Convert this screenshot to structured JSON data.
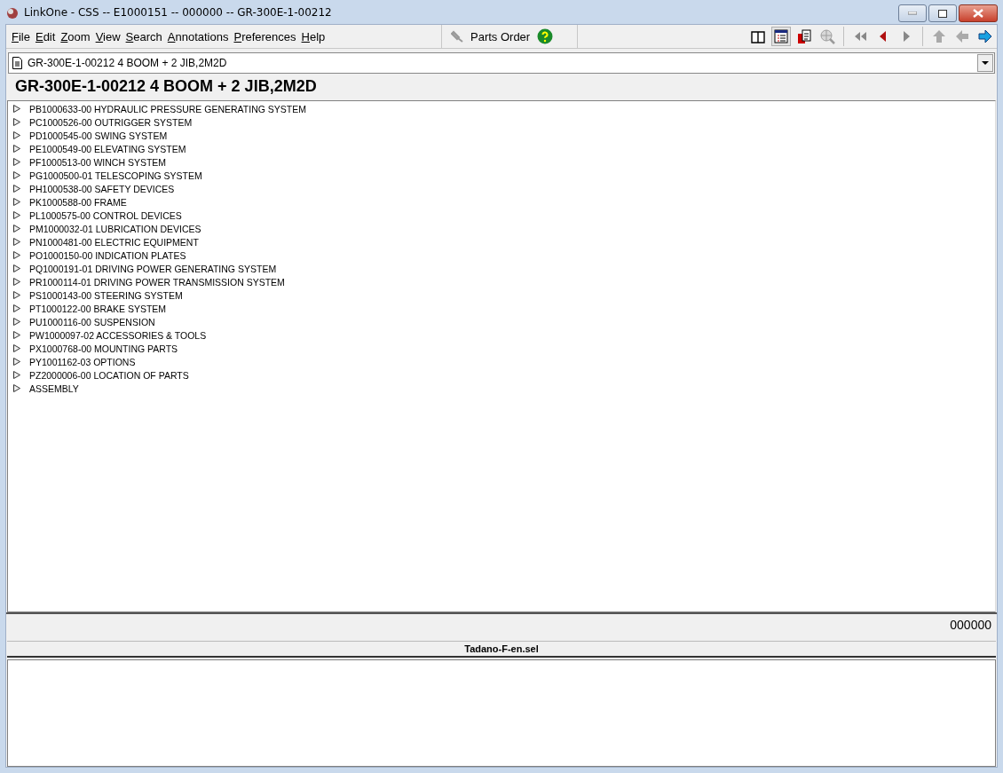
{
  "window": {
    "title": "LinkOne - CSS -- E1000151 -- 000000 -- GR-300E-1-00212"
  },
  "menu": [
    "File",
    "Edit",
    "Zoom",
    "View",
    "Search",
    "Annotations",
    "Preferences",
    "Help"
  ],
  "parts_order": {
    "label": "Parts Order"
  },
  "toolbar": [
    {
      "kind": "book",
      "disabled": false,
      "pressed": false
    },
    {
      "kind": "list",
      "disabled": false,
      "pressed": true
    },
    {
      "kind": "pages",
      "disabled": false,
      "pressed": false
    },
    {
      "kind": "globe-search",
      "disabled": true,
      "pressed": false
    },
    {
      "kind": "first",
      "disabled": true,
      "pressed": false
    },
    {
      "kind": "prev",
      "disabled": false,
      "pressed": false
    },
    {
      "kind": "next",
      "disabled": true,
      "pressed": false
    },
    {
      "kind": "up",
      "disabled": true,
      "pressed": false
    },
    {
      "kind": "back",
      "disabled": true,
      "pressed": false
    },
    {
      "kind": "forward",
      "disabled": false,
      "pressed": false
    }
  ],
  "document_select": {
    "value": "GR-300E-1-00212 4 BOOM + 2 JIB,2M2D"
  },
  "heading": "GR-300E-1-00212 4 BOOM + 2 JIB,2M2D",
  "tree": [
    {
      "label": "PB1000633-00 HYDRAULIC PRESSURE GENERATING SYSTEM"
    },
    {
      "label": "PC1000526-00 OUTRIGGER SYSTEM"
    },
    {
      "label": "PD1000545-00 SWING SYSTEM"
    },
    {
      "label": "PE1000549-00 ELEVATING SYSTEM"
    },
    {
      "label": "PF1000513-00 WINCH SYSTEM"
    },
    {
      "label": "PG1000500-01 TELESCOPING SYSTEM"
    },
    {
      "label": "PH1000538-00 SAFETY DEVICES"
    },
    {
      "label": "PK1000588-00 FRAME"
    },
    {
      "label": "PL1000575-00 CONTROL DEVICES"
    },
    {
      "label": "PM1000032-01 LUBRICATION DEVICES"
    },
    {
      "label": "PN1000481-00 ELECTRIC EQUIPMENT"
    },
    {
      "label": "PO1000150-00 INDICATION PLATES"
    },
    {
      "label": "PQ1000191-01 DRIVING POWER GENERATING SYSTEM"
    },
    {
      "label": "PR1000114-01 DRIVING POWER TRANSMISSION SYSTEM"
    },
    {
      "label": "PS1000143-00 STEERING SYSTEM"
    },
    {
      "label": "PT1000122-00 BRAKE SYSTEM"
    },
    {
      "label": "PU1000116-00 SUSPENSION"
    },
    {
      "label": "PW1000097-02 ACCESSORIES & TOOLS"
    },
    {
      "label": "PX1000768-00 MOUNTING PARTS"
    },
    {
      "label": "PY1001162-03 OPTIONS"
    },
    {
      "label": "PZ2000006-00 LOCATION OF PARTS"
    },
    {
      "label": "ASSEMBLY"
    }
  ],
  "status": "000000",
  "lower_pane": {
    "title": "Tadano-F-en.sel"
  }
}
